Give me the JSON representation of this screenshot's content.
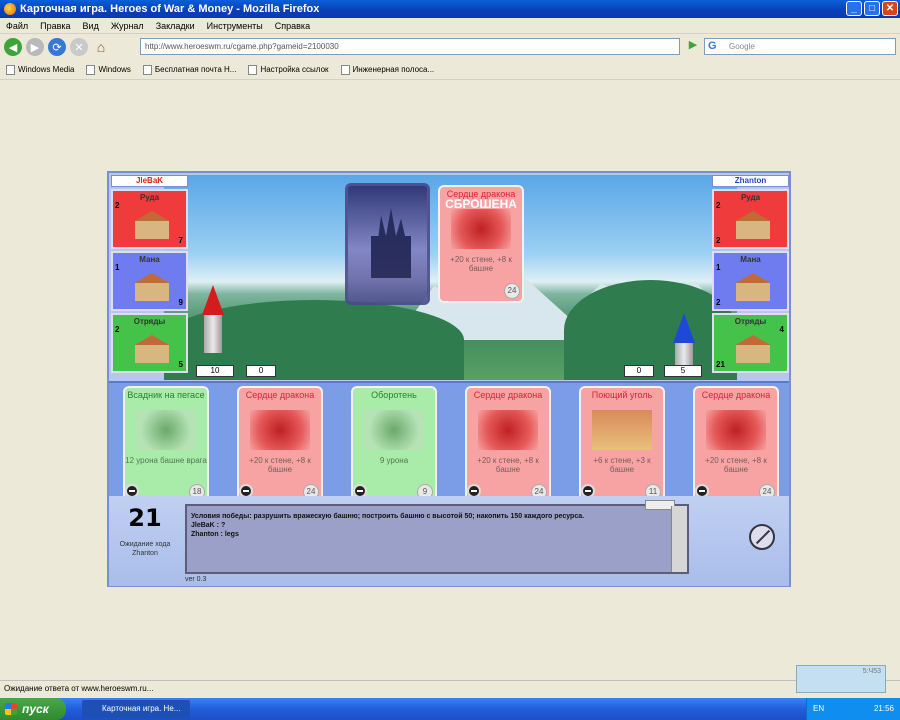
{
  "window": {
    "title": "Карточная игра. Heroes of War & Money - Mozilla Firefox",
    "minimize": "_",
    "maximize": "□",
    "close": "✕"
  },
  "menu": [
    "Файл",
    "Правка",
    "Вид",
    "Журнал",
    "Закладки",
    "Инструменты",
    "Справка"
  ],
  "nav": {
    "url": "http://www.heroeswm.ru/cgame.php?gameid=2100030",
    "search_placeholder": "Google"
  },
  "bookmarks": [
    "Windows Media",
    "Windows",
    "Бесплатная почта H...",
    "Настройка ссылок",
    "Инженерная полоса..."
  ],
  "game": {
    "player_left": {
      "name": "JleBaK",
      "resources": [
        {
          "name": "Руда",
          "production": "2",
          "stock": "7",
          "color": "red"
        },
        {
          "name": "Мана",
          "production": "1",
          "stock": "9",
          "color": "blue"
        },
        {
          "name": "Отряды",
          "production": "2",
          "stock": "5",
          "color": "green"
        }
      ],
      "tower": "10",
      "wall": "0"
    },
    "player_right": {
      "name": "Zhanton",
      "resources": [
        {
          "name": "Руда",
          "production": "2",
          "stock": "2",
          "color": "red"
        },
        {
          "name": "Мана",
          "production": "1",
          "stock": "2",
          "color": "blue"
        },
        {
          "name": "Отряды",
          "production": "4",
          "stock": "21",
          "color": "green"
        }
      ],
      "tower": "5",
      "wall": "0"
    },
    "played_card": {
      "title": "Сердце дракона",
      "overlay": "СБРОШЕНА",
      "desc": "+20 к стене, +8 к башне",
      "cost": "24"
    },
    "hand": [
      {
        "title": "Всадник на пегасе",
        "desc": "12 урона башне врага",
        "cost": "18",
        "color": "green"
      },
      {
        "title": "Сердце дракона",
        "desc": "+20 к стене, +8 к башне",
        "cost": "24",
        "color": "red"
      },
      {
        "title": "Оборотень",
        "desc": "9 урона",
        "cost": "9",
        "color": "green"
      },
      {
        "title": "Сердце дракона",
        "desc": "+20 к стене, +8 к башне",
        "cost": "24",
        "color": "red"
      },
      {
        "title": "Поющий уголь",
        "desc": "+6 к стене, +3 к башне",
        "cost": "11",
        "color": "red"
      },
      {
        "title": "Сердце дракона",
        "desc": "+20 к стене, +8 к башне",
        "cost": "24",
        "color": "red"
      }
    ],
    "turn": {
      "count": "21",
      "label": "Ожидание хода",
      "player": "Zhanton"
    },
    "log": [
      "Условия победы: разрушить вражескую башню; построить башню с высотой 50; накопить 150 каждого ресурса.",
      "JleBaK : ?",
      "Zhanton : legs"
    ],
    "version": "ver 0.3"
  },
  "status": "Ожидание ответа от www.heroeswm.ru...",
  "tray_popup": "5:Ч53",
  "taskbar": {
    "start": "пуск",
    "item": "Карточная игра. He...",
    "lang": "EN",
    "time": "21:56"
  }
}
